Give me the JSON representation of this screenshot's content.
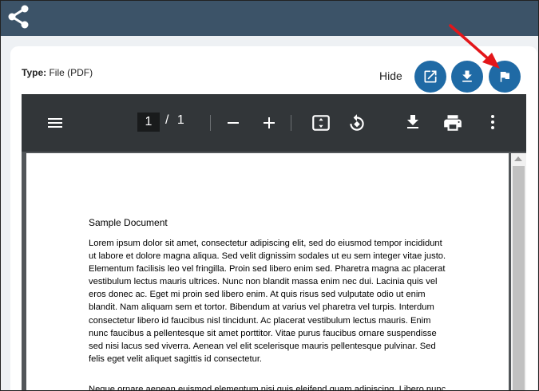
{
  "header": {
    "logo_icon": "share-network-icon"
  },
  "file_info": {
    "type_label": "Type:",
    "type_value": "File (PDF)"
  },
  "actions": {
    "hide_label": "Hide",
    "buttons": [
      {
        "icon": "open-external-icon"
      },
      {
        "icon": "download-icon"
      },
      {
        "icon": "flag-icon"
      }
    ]
  },
  "pdf_toolbar": {
    "current_page": "1",
    "separator": "/",
    "total_pages": "1",
    "icons": [
      "menu-icon",
      "zoom-out-icon",
      "zoom-in-icon",
      "fit-page-icon",
      "rotate-icon",
      "download-icon",
      "print-icon",
      "more-vert-icon"
    ]
  },
  "document": {
    "title": "Sample Document",
    "paragraphs": [
      "Lorem ipsum dolor sit amet, consectetur adipiscing elit, sed do eiusmod tempor incididunt ut labore et dolore magna aliqua. Sed velit dignissim sodales ut eu sem integer vitae justo. Elementum facilisis leo vel fringilla. Proin sed libero enim sed. Pharetra magna ac placerat vestibulum lectus mauris ultrices. Nunc non blandit massa enim nec dui. Lacinia quis vel eros donec ac. Eget mi proin sed libero enim. At quis risus sed vulputate odio ut enim blandit. Nam aliquam sem et tortor. Bibendum at varius vel pharetra vel turpis. Interdum consectetur libero id faucibus nisl tincidunt. Ac placerat vestibulum lectus mauris. Enim nunc faucibus a pellentesque sit amet porttitor. Vitae purus faucibus ornare suspendisse sed nisi lacus sed viverra. Aenean vel elit scelerisque mauris pellentesque pulvinar. Sed felis eget velit aliquet sagittis id consectetur.",
      "Neque ornare aenean euismod elementum nisi quis eleifend quam adipiscing. Libero nunc"
    ]
  },
  "colors": {
    "header": "#3c5368",
    "accent": "#1f6aa5",
    "arrow": "#e3161a",
    "toolbar": "#323639"
  }
}
